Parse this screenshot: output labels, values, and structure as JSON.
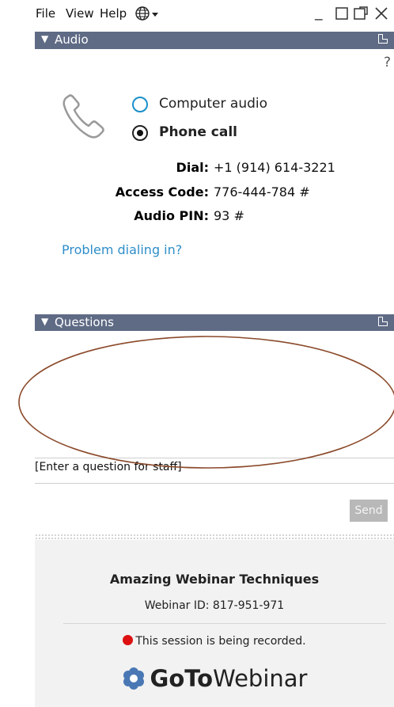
{
  "menu": {
    "file": "File",
    "view": "View",
    "help": "Help",
    "globe_icon": "globe-icon",
    "window_controls": [
      "minimize-icon",
      "restore-icon",
      "popout-icon",
      "close-icon"
    ]
  },
  "audio_panel": {
    "header": "Audio",
    "help_symbol": "?",
    "options": {
      "computer_audio": "Computer audio",
      "phone_call": "Phone call",
      "selected": "Phone call"
    },
    "dial_label": "Dial:",
    "dial_value": "+1 (914) 614-3221",
    "access_code_label": "Access Code:",
    "access_code_value": "776-444-784 #",
    "audio_pin_label": "Audio PIN:",
    "audio_pin_value": "93 #",
    "problem_link": "Problem dialing in?"
  },
  "questions_panel": {
    "header": "Questions",
    "input_placeholder": "[Enter a question for staff]",
    "send_label": "Send"
  },
  "footer": {
    "webinar_title": "Amazing Webinar Techniques",
    "webinar_id": "Webinar ID: 817-951-971",
    "recording_notice": "This session is being recorded.",
    "brand_bold": "GoTo",
    "brand_light": "Webinar"
  },
  "colors": {
    "header_bg": "#5f6b85",
    "link": "#2f8ec9",
    "radio_accent": "#1a8fc9",
    "recording_dot": "#dd1111",
    "annotation_ellipse": "#8b4a2b"
  }
}
